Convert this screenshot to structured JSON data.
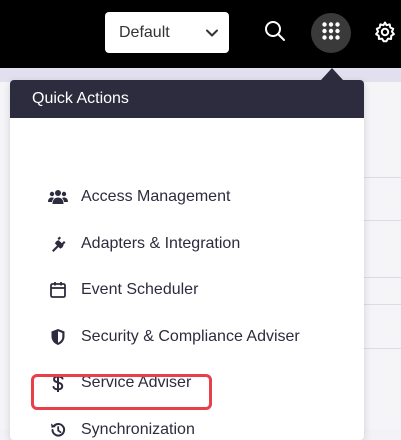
{
  "topbar": {
    "view_select": {
      "value": "Default",
      "icon": "chevron-down-icon"
    },
    "search_button": {
      "icon": "search-icon"
    },
    "apps_button": {
      "icon": "grid-dots-icon"
    },
    "settings_button": {
      "icon": "gear-icon"
    }
  },
  "quick_actions": {
    "title": "Quick Actions",
    "items": [
      {
        "label": "Access Management",
        "icon": "users-icon"
      },
      {
        "label": "Adapters & Integration",
        "icon": "plug-icon"
      },
      {
        "label": "Event Scheduler",
        "icon": "calendar-icon"
      },
      {
        "label": "Security & Compliance Adviser",
        "icon": "shield-icon"
      },
      {
        "label": "Service Adviser",
        "icon": "dollar-icon"
      },
      {
        "label": "Synchronization",
        "icon": "history-icon",
        "highlighted": true
      }
    ]
  },
  "colors": {
    "topbar_bg": "#000000",
    "menu_header_bg": "#2c2c3e",
    "highlight_border": "#e8404a"
  }
}
